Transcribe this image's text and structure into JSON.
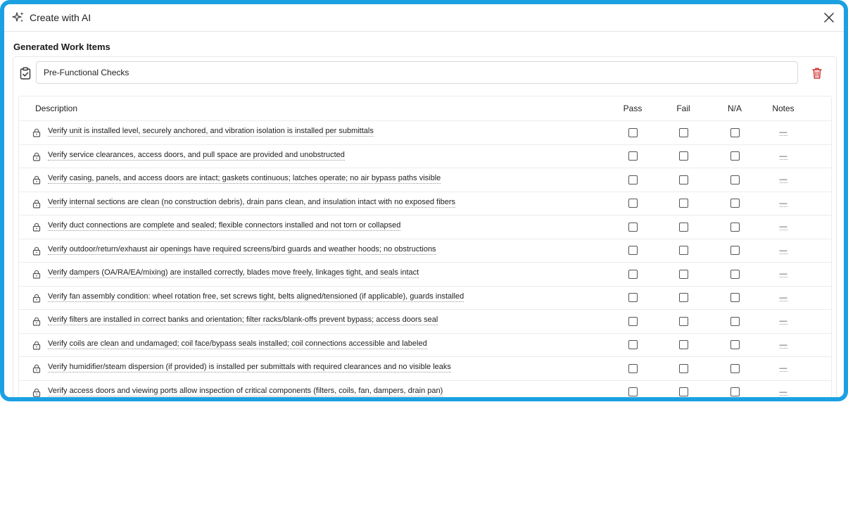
{
  "dialog": {
    "title": "Create with AI",
    "section_title": "Generated Work Items"
  },
  "group": {
    "name": "Pre-Functional Checks"
  },
  "table": {
    "headers": {
      "description": "Description",
      "pass": "Pass",
      "fail": "Fail",
      "na": "N/A",
      "notes": "Notes"
    },
    "rows": [
      {
        "description": "Verify unit is installed level, securely anchored, and vibration isolation is installed per submittals",
        "notes": "—"
      },
      {
        "description": "Verify service clearances, access doors, and pull space are provided and unobstructed",
        "notes": "—"
      },
      {
        "description": "Verify casing, panels, and access doors are intact; gaskets continuous; latches operate; no air bypass paths visible",
        "notes": "—"
      },
      {
        "description": "Verify internal sections are clean (no construction debris), drain pans clean, and insulation intact with no exposed fibers",
        "notes": "—"
      },
      {
        "description": "Verify duct connections are complete and sealed; flexible connectors installed and not torn or collapsed",
        "notes": "—"
      },
      {
        "description": "Verify outdoor/return/exhaust air openings have required screens/bird guards and weather hoods; no obstructions",
        "notes": "—"
      },
      {
        "description": "Verify dampers (OA/RA/EA/mixing) are installed correctly, blades move freely, linkages tight, and seals intact",
        "notes": "—"
      },
      {
        "description": "Verify fan assembly condition: wheel rotation free, set screws tight, belts aligned/tensioned (if applicable), guards installed",
        "notes": "—"
      },
      {
        "description": "Verify filters are installed in correct banks and orientation; filter racks/blank-offs prevent bypass; access doors seal",
        "notes": "—"
      },
      {
        "description": "Verify coils are clean and undamaged; coil face/bypass seals installed; coil connections accessible and labeled",
        "notes": "—"
      },
      {
        "description": "Verify humidifier/steam dispersion (if provided) is installed per submittals with required clearances and no visible leaks",
        "notes": "—"
      },
      {
        "description": "Verify access doors and viewing ports allow inspection of critical components (filters, coils, fan, dampers, drain pan)",
        "notes": "—"
      }
    ]
  },
  "icons": {
    "sparkle": "sparkle-icon",
    "close": "close-icon",
    "clipboard": "clipboard-check-icon",
    "trash": "trash-icon",
    "lock": "lock-icon"
  },
  "colors": {
    "frame": "#1ba1e2",
    "danger": "#d32f2f"
  }
}
